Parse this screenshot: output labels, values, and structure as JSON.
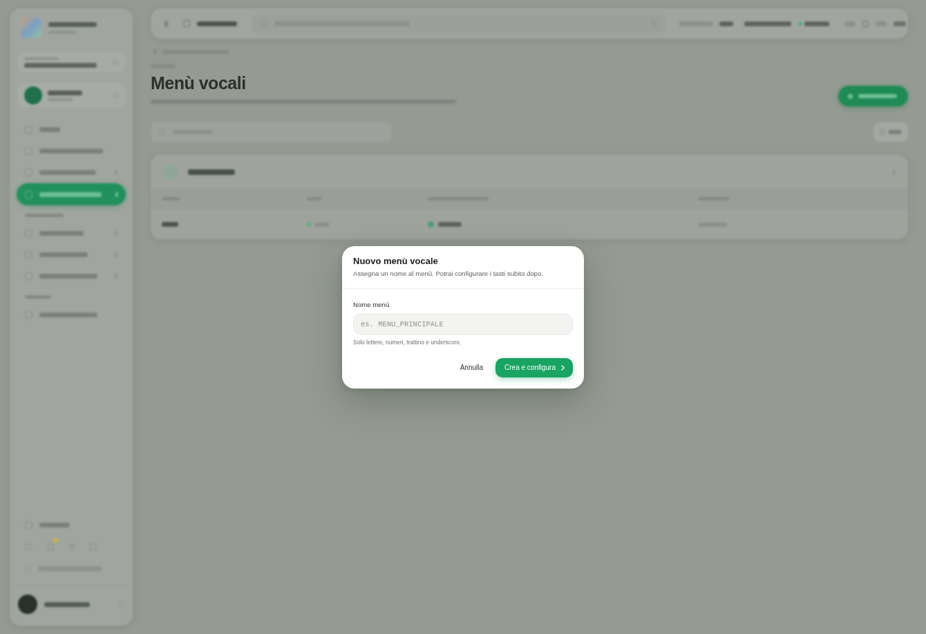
{
  "page": {
    "title": "Menù vocali"
  },
  "dialog": {
    "title": "Nuovo menù vocale",
    "subtitle": "Assegna un nome al menù. Potrai configurare i tasti subito dopo.",
    "field": {
      "label": "Nome menù",
      "placeholder": "es. MENU_PRINCIPALE",
      "hint": "Solo lettere, numeri, trattino e underscore."
    },
    "actions": [
      {
        "label": "Annulla",
        "kind": "secondary"
      },
      {
        "label": "Crea e configura",
        "kind": "primary"
      }
    ]
  }
}
